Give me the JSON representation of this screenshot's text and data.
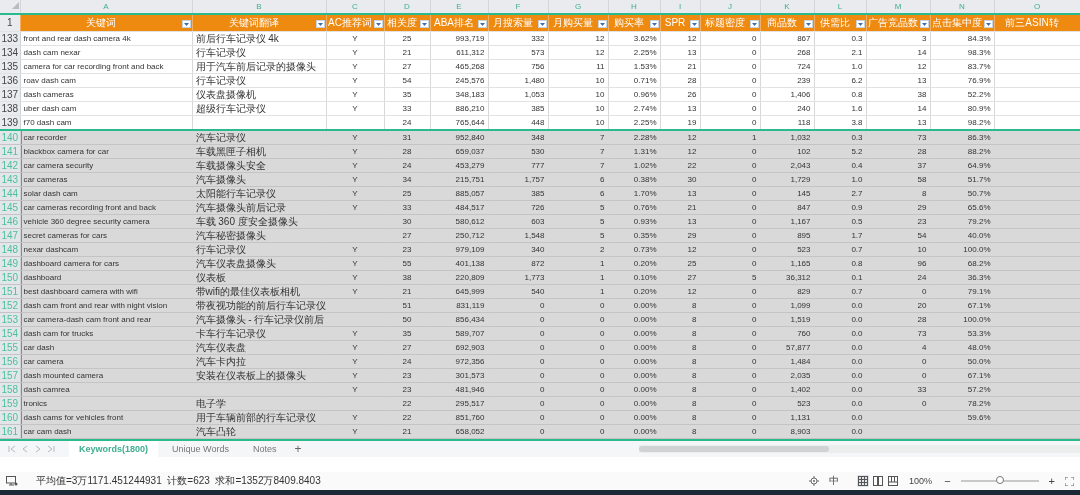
{
  "columns": [
    {
      "letter": "A",
      "title": "关键词",
      "kind": "text",
      "filter": true
    },
    {
      "letter": "B",
      "title": "关键词翻译",
      "kind": "cjk",
      "filter": true
    },
    {
      "letter": "C",
      "title": "AC推荐词",
      "kind": "flag",
      "filter": true
    },
    {
      "letter": "D",
      "title": "相关度",
      "kind": "flag",
      "filter": true
    },
    {
      "letter": "E",
      "title": "ABA排名",
      "kind": "number",
      "filter": true
    },
    {
      "letter": "F",
      "title": "月搜索量",
      "kind": "number",
      "filter": true
    },
    {
      "letter": "G",
      "title": "月购买量",
      "kind": "number",
      "filter": true
    },
    {
      "letter": "H",
      "title": "购买率",
      "kind": "number",
      "filter": true
    },
    {
      "letter": "I",
      "title": "SPR",
      "kind": "number",
      "filter": true
    },
    {
      "letter": "J",
      "title": "标题密度",
      "kind": "number",
      "filter": true
    },
    {
      "letter": "K",
      "title": "商品数",
      "kind": "number",
      "filter": true
    },
    {
      "letter": "L",
      "title": "供需比",
      "kind": "number",
      "filter": true
    },
    {
      "letter": "M",
      "title": "广告竞品数",
      "kind": "number",
      "filter": true
    },
    {
      "letter": "N",
      "title": "点击集中度",
      "kind": "number",
      "filter": true
    },
    {
      "letter": "O",
      "title": "前三ASIN转",
      "kind": "text",
      "filter": false
    }
  ],
  "header_row": "1",
  "rows": [
    {
      "num": "133",
      "selected": false,
      "cells": [
        "front and rear dash camera 4k",
        "前后行车记录仪 4k",
        "Y",
        "25",
        "993,719",
        "332",
        "12",
        "3.62%",
        "12",
        "0",
        "867",
        "0.3",
        "3",
        "84.3%"
      ]
    },
    {
      "num": "134",
      "selected": false,
      "cells": [
        "dash cam nexar",
        "行车记录仪",
        "Y",
        "21",
        "611,312",
        "573",
        "12",
        "2.25%",
        "13",
        "0",
        "268",
        "2.1",
        "14",
        "98.3%"
      ]
    },
    {
      "num": "135",
      "selected": false,
      "cells": [
        "camera for car recording front and back",
        "用于汽车前后记录的摄像头",
        "Y",
        "27",
        "465,268",
        "756",
        "11",
        "1.53%",
        "21",
        "0",
        "724",
        "1.0",
        "12",
        "83.7%"
      ]
    },
    {
      "num": "136",
      "selected": false,
      "cells": [
        "roav dash cam",
        "行车记录仪",
        "Y",
        "54",
        "245,576",
        "1,480",
        "10",
        "0.71%",
        "28",
        "0",
        "239",
        "6.2",
        "13",
        "76.9%"
      ]
    },
    {
      "num": "137",
      "selected": false,
      "cells": [
        "dash cameras",
        "仪表盘摄像机",
        "Y",
        "35",
        "348,183",
        "1,053",
        "10",
        "0.96%",
        "26",
        "0",
        "1,406",
        "0.8",
        "38",
        "52.2%"
      ]
    },
    {
      "num": "138",
      "selected": false,
      "cells": [
        "uber dash cam",
        "超级行车记录仪",
        "Y",
        "33",
        "886,210",
        "385",
        "10",
        "2.74%",
        "13",
        "0",
        "240",
        "1.6",
        "14",
        "80.9%"
      ]
    },
    {
      "num": "139",
      "selected": false,
      "cells": [
        "f70 dash cam",
        null,
        null,
        "24",
        "765,644",
        "448",
        "10",
        "2.25%",
        "19",
        "0",
        "118",
        "3.8",
        "13",
        "98.2%"
      ]
    },
    {
      "num": "140",
      "selected": true,
      "cells": [
        "car recorder",
        "汽车记录仪",
        "Y",
        "31",
        "952,840",
        "348",
        "7",
        "2.28%",
        "12",
        "1",
        "1,032",
        "0.3",
        "73",
        "86.3%"
      ]
    },
    {
      "num": "141",
      "selected": true,
      "cells": [
        "blackbox camera for car",
        "车载黑匣子相机",
        "Y",
        "28",
        "659,037",
        "530",
        "7",
        "1.31%",
        "12",
        "0",
        "102",
        "5.2",
        "28",
        "88.2%"
      ]
    },
    {
      "num": "142",
      "selected": true,
      "cells": [
        "car camera security",
        "车载摄像头安全",
        "Y",
        "24",
        "453,279",
        "777",
        "7",
        "1.02%",
        "22",
        "0",
        "2,043",
        "0.4",
        "37",
        "64.9%"
      ]
    },
    {
      "num": "143",
      "selected": true,
      "cells": [
        "car cameras",
        "汽车摄像头",
        "Y",
        "34",
        "215,751",
        "1,757",
        "6",
        "0.38%",
        "30",
        "0",
        "1,729",
        "1.0",
        "58",
        "51.7%"
      ]
    },
    {
      "num": "144",
      "selected": true,
      "cells": [
        "solar dash cam",
        "太阳能行车记录仪",
        "Y",
        "25",
        "885,057",
        "385",
        "6",
        "1.70%",
        "13",
        "0",
        "145",
        "2.7",
        "8",
        "50.7%"
      ]
    },
    {
      "num": "145",
      "selected": true,
      "cells": [
        "car cameras recording front and back",
        "汽车摄像头前后记录",
        "Y",
        "33",
        "484,517",
        "726",
        "5",
        "0.76%",
        "21",
        "0",
        "847",
        "0.9",
        "29",
        "65.6%"
      ]
    },
    {
      "num": "146",
      "selected": true,
      "cells": [
        "vehicle 360 degree security camera",
        "车载 360 度安全摄像头",
        null,
        "30",
        "580,612",
        "603",
        "5",
        "0.93%",
        "13",
        "0",
        "1,167",
        "0.5",
        "23",
        "79.2%"
      ]
    },
    {
      "num": "147",
      "selected": true,
      "cells": [
        "secret cameras for cars",
        "汽车秘密摄像头",
        null,
        "27",
        "250,712",
        "1,548",
        "5",
        "0.35%",
        "29",
        "0",
        "895",
        "1.7",
        "54",
        "40.0%"
      ]
    },
    {
      "num": "148",
      "selected": true,
      "cells": [
        "nexar dashcam",
        "行车记录仪",
        "Y",
        "23",
        "979,109",
        "340",
        "2",
        "0.73%",
        "12",
        "0",
        "523",
        "0.7",
        "10",
        "100.0%"
      ]
    },
    {
      "num": "149",
      "selected": true,
      "cells": [
        "dashboard camera for cars",
        "汽车仪表盘摄像头",
        "Y",
        "55",
        "401,138",
        "872",
        "1",
        "0.20%",
        "25",
        "0",
        "1,165",
        "0.8",
        "96",
        "68.2%"
      ]
    },
    {
      "num": "150",
      "selected": true,
      "cells": [
        "dashboard",
        "仪表板",
        "Y",
        "38",
        "220,809",
        "1,773",
        "1",
        "0.10%",
        "27",
        "5",
        "36,312",
        "0.1",
        "24",
        "36.3%"
      ]
    },
    {
      "num": "151",
      "selected": true,
      "cells": [
        "best dashboard camera with wifi",
        "带wifi的最佳仪表板相机",
        "Y",
        "21",
        "645,999",
        "540",
        "1",
        "0.20%",
        "12",
        "0",
        "829",
        "0.7",
        "0",
        "79.1%"
      ]
    },
    {
      "num": "152",
      "selected": true,
      "cells": [
        "dash cam front and rear with night vision",
        "带夜视功能的前后行车记录仪",
        null,
        "51",
        "831,119",
        "0",
        "0",
        "0.00%",
        "8",
        "0",
        "1,099",
        "0.0",
        "20",
        "67.1%"
      ]
    },
    {
      "num": "153",
      "selected": true,
      "cells": [
        "car camera-dash cam front and rear",
        "汽车摄像头 - 行车记录仪前后",
        null,
        "50",
        "856,434",
        "0",
        "0",
        "0.00%",
        "8",
        "0",
        "1,519",
        "0.0",
        "28",
        "100.0%"
      ]
    },
    {
      "num": "154",
      "selected": true,
      "cells": [
        "dash cam for trucks",
        "卡车行车记录仪",
        "Y",
        "35",
        "589,707",
        "0",
        "0",
        "0.00%",
        "8",
        "0",
        "760",
        "0.0",
        "73",
        "53.3%"
      ]
    },
    {
      "num": "155",
      "selected": true,
      "cells": [
        "car dash",
        "汽车仪表盘",
        "Y",
        "27",
        "692,903",
        "0",
        "0",
        "0.00%",
        "8",
        "0",
        "57,877",
        "0.0",
        "4",
        "48.0%"
      ]
    },
    {
      "num": "156",
      "selected": true,
      "cells": [
        "car camera",
        "汽车卡内拉",
        "Y",
        "24",
        "972,356",
        "0",
        "0",
        "0.00%",
        "8",
        "0",
        "1,484",
        "0.0",
        "0",
        "50.0%"
      ]
    },
    {
      "num": "157",
      "selected": true,
      "cells": [
        "dash mounted camera",
        "安装在仪表板上的摄像头",
        "Y",
        "23",
        "301,573",
        "0",
        "0",
        "0.00%",
        "8",
        "0",
        "2,035",
        "0.0",
        "0",
        "67.1%"
      ]
    },
    {
      "num": "158",
      "selected": true,
      "cells": [
        "dash camrea",
        null,
        "Y",
        "23",
        "481,946",
        "0",
        "0",
        "0.00%",
        "8",
        "0",
        "1,402",
        "0.0",
        "33",
        "57.2%"
      ]
    },
    {
      "num": "159",
      "selected": true,
      "cells": [
        "tronics",
        "电子学",
        null,
        "22",
        "295,517",
        "0",
        "0",
        "0.00%",
        "8",
        "0",
        "523",
        "0.0",
        "0",
        "78.2%"
      ]
    },
    {
      "num": "160",
      "selected": true,
      "cells": [
        "dash cams for vehicles front",
        "用于车辆前部的行车记录仪",
        "Y",
        "22",
        "851,760",
        "0",
        "0",
        "0.00%",
        "8",
        "0",
        "1,131",
        "0.0",
        null,
        "59.6%"
      ]
    },
    {
      "num": "161",
      "selected": true,
      "cells": [
        "car cam dash",
        "汽车凸轮",
        "Y",
        "21",
        "658,052",
        "0",
        "0",
        "0.00%",
        "8",
        "0",
        "8,903",
        "0.0",
        null,
        null
      ]
    }
  ],
  "sheet_tabs": [
    {
      "label": "Keywords(1800)",
      "selected": true
    },
    {
      "label": "Unique Words",
      "selected": false
    },
    {
      "label": "Notes",
      "selected": false
    }
  ],
  "add_sheet": "+",
  "status_bar": {
    "stats": "平均值=3万1171.451244931  计数=623  求和=1352万8409.8403",
    "input_method": "中",
    "views": [
      {
        "selected": true
      },
      {
        "selected": false
      },
      {
        "selected": false
      }
    ],
    "zoom": "100%",
    "zoom_out": "−",
    "zoom_in": "+",
    "zoom_slider": {
      "level": 0.5
    }
  }
}
